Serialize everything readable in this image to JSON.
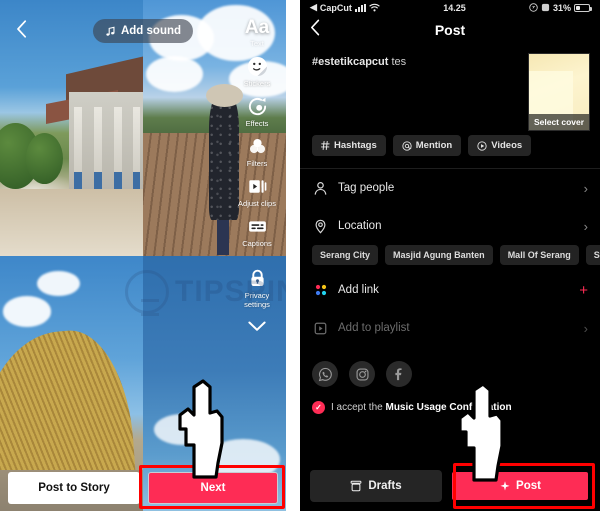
{
  "left_panel": {
    "back_icon": "chevron-left-icon",
    "add_sound": {
      "label": "Add sound",
      "icon": "music-note-icon"
    },
    "sidebar": [
      {
        "id": "text",
        "icon": "text-aa-icon",
        "label": "Text"
      },
      {
        "id": "stickers",
        "icon": "sticker-icon",
        "label": "Stickers"
      },
      {
        "id": "effects",
        "icon": "effects-icon",
        "label": "Effects"
      },
      {
        "id": "filters",
        "icon": "filters-icon",
        "label": "Filters"
      },
      {
        "id": "adjust",
        "icon": "adjust-clips-icon",
        "label": "Adjust clips"
      },
      {
        "id": "captions",
        "icon": "captions-icon",
        "label": "Captions"
      },
      {
        "id": "privacy",
        "icon": "lock-icon",
        "label": "Privacy settings"
      }
    ],
    "collapse_icon": "chevron-down-icon",
    "post_to_story": "Post to Story",
    "next": "Next",
    "watermark": "TIPSPIN"
  },
  "right_panel": {
    "statusbar": {
      "carrier": "CapCut",
      "back_arrow": "◀",
      "signal_icon": "signal-bars-icon",
      "wifi_icon": "wifi-icon",
      "time": "14.25",
      "location_icon": "location-arrow-icon",
      "alarm_icon": "alarm-icon",
      "battery_percent": "31%"
    },
    "header": {
      "back_icon": "chevron-left-icon",
      "title": "Post"
    },
    "caption": {
      "hashtag": "#estetikcapcut",
      "text": "tes"
    },
    "cover": {
      "label": "Select cover"
    },
    "chips": [
      {
        "icon": "hash-icon",
        "label": "Hashtags"
      },
      {
        "icon": "at-icon",
        "label": "Mention"
      },
      {
        "icon": "video-icon",
        "label": "Videos"
      }
    ],
    "rows": [
      {
        "id": "tag-people",
        "icon": "person-icon",
        "label": "Tag people",
        "accessory": "chevron",
        "dim": false
      },
      {
        "id": "location",
        "icon": "location-pin-icon",
        "label": "Location",
        "accessory": "chevron",
        "dim": false
      },
      {
        "id": "add-link",
        "icon": "grid-dots-icon",
        "label": "Add link",
        "accessory": "plus",
        "dim": false
      },
      {
        "id": "add-to-playlist",
        "icon": "playlist-icon",
        "label": "Add to playlist",
        "accessory": "chevron",
        "dim": true
      }
    ],
    "location_suggestions": [
      "Serang City",
      "Masjid Agung Banten",
      "Mall Of Serang",
      "Stadion Banten"
    ],
    "share_icons": [
      {
        "id": "whatsapp",
        "icon": "whatsapp-icon"
      },
      {
        "id": "instagram",
        "icon": "instagram-icon"
      },
      {
        "id": "facebook",
        "icon": "facebook-icon"
      }
    ],
    "music_usage": {
      "checkbox_icon": "checked-circle-icon",
      "prefix": "I accept the ",
      "link": "Music Usage Confirmation"
    },
    "drafts": {
      "label": "Drafts",
      "icon": "drafts-box-icon"
    },
    "post": {
      "label": "Post",
      "icon": "sparkle-icon"
    }
  },
  "colors": {
    "accent_pink": "#fe2c55",
    "highlight_red": "#ff0000",
    "panel_bg": "#000000",
    "chip_bg": "#252525"
  }
}
